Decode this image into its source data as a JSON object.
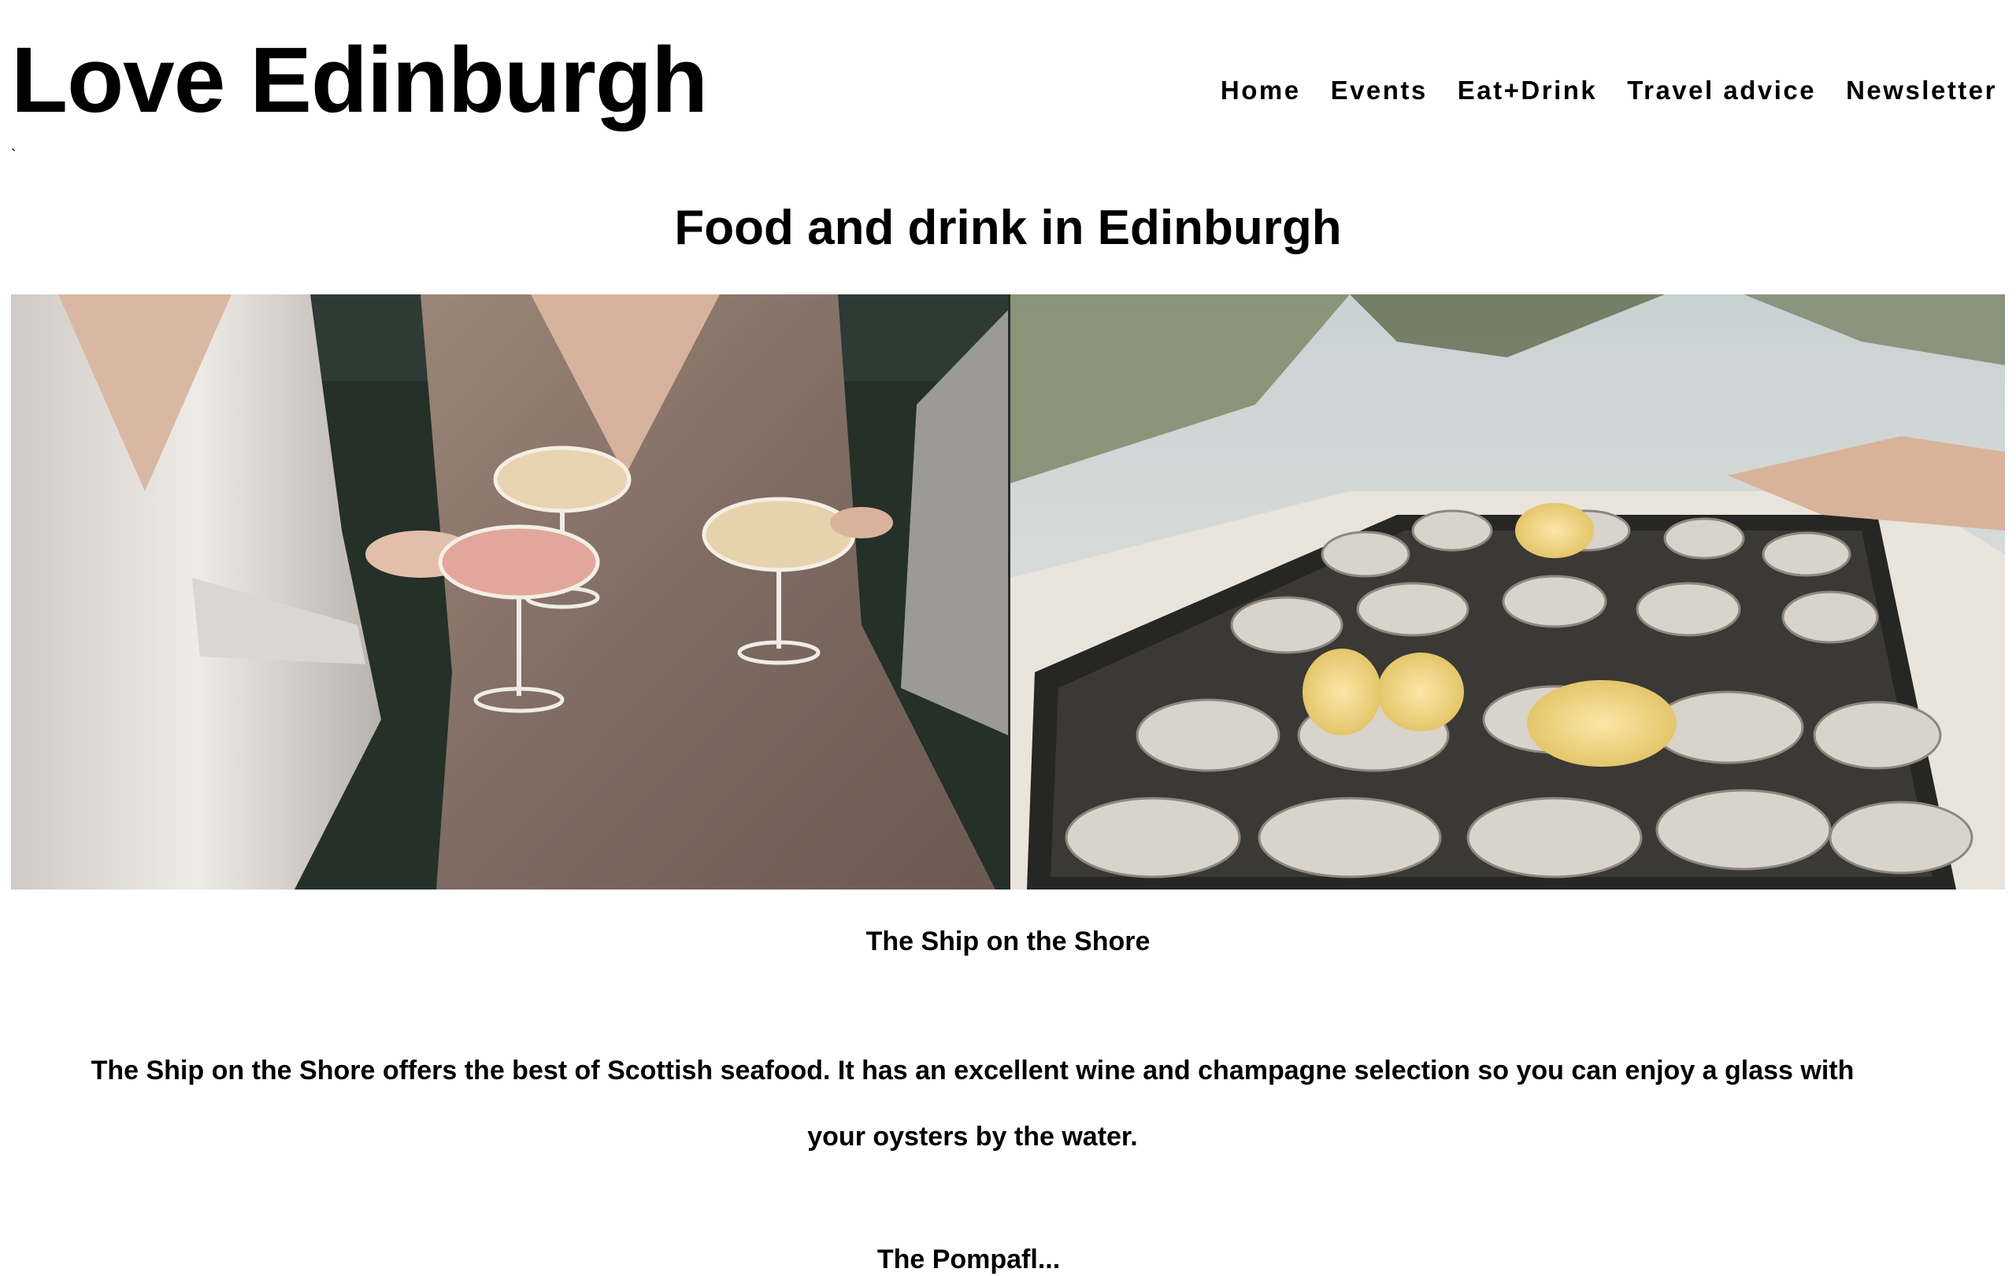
{
  "site": {
    "title": "Love Edinburgh",
    "tick": "`"
  },
  "nav": {
    "items": [
      {
        "label": "Home"
      },
      {
        "label": "Events"
      },
      {
        "label": "Eat+Drink"
      },
      {
        "label": "Travel advice"
      },
      {
        "label": "Newsletter"
      }
    ]
  },
  "main": {
    "page_title": "Food and drink in Edinburgh",
    "section": {
      "heading": "The Ship on the Shore",
      "body": "The Ship on the Shore offers the best of Scottish seafood. It has an excellent wine and champagne selection so you can enjoy a glass with your oysters by the water."
    },
    "next_heading": "The Pompafl..."
  },
  "colors": {
    "background": "#ffffff",
    "text": "#000000"
  }
}
